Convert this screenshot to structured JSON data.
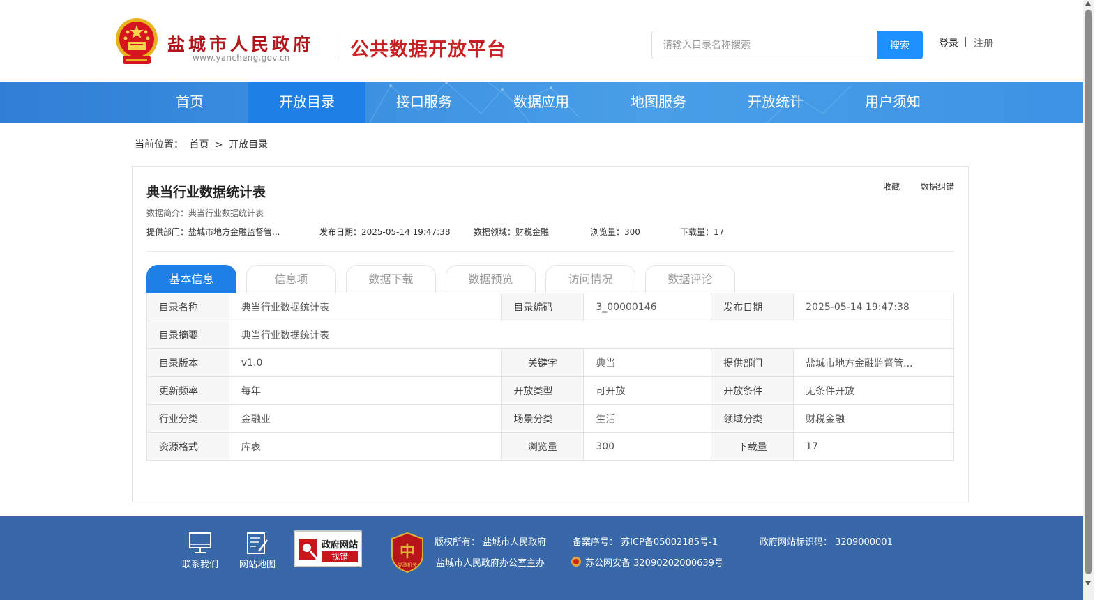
{
  "header": {
    "site_name": "盐城市人民政府",
    "site_url": "www.yancheng.gov.cn",
    "platform_title": "公共数据开放平台",
    "search_placeholder": "请输入目录名称搜索",
    "search_button": "搜索",
    "login": "登录",
    "separator": "|",
    "register": "注册"
  },
  "nav": {
    "items": [
      {
        "label": "首页"
      },
      {
        "label": "开放目录"
      },
      {
        "label": "接口服务"
      },
      {
        "label": "数据应用"
      },
      {
        "label": "地图服务"
      },
      {
        "label": "开放统计"
      },
      {
        "label": "用户须知"
      }
    ],
    "active": "开放目录"
  },
  "breadcrumb": {
    "prefix": "当前位置：",
    "home": "首页",
    "sep": ">",
    "current": "开放目录"
  },
  "dataset": {
    "title": "典当行业数据统计表",
    "collect": "收藏",
    "correct": "数据纠错",
    "summary": "数据简介：典当行业数据统计表",
    "dept": "提供部门：盐城市地方金融监督管...",
    "publish": "发布日期：2025-05-14 19:47:38",
    "field": "数据领域：财税金融",
    "views": "浏览量：300",
    "downloads": "下载量：17"
  },
  "tabs": [
    {
      "label": "基本信息"
    },
    {
      "label": "信息项"
    },
    {
      "label": "数据下载"
    },
    {
      "label": "数据预览"
    },
    {
      "label": "访问情况"
    },
    {
      "label": "数据评论"
    }
  ],
  "info": {
    "r1": {
      "k1": "目录名称",
      "v1": "典当行业数据统计表",
      "k2": "目录编码",
      "v2": "3_00000146",
      "k3": "发布日期",
      "v3": "2025-05-14 19:47:38"
    },
    "r2": {
      "k1": "目录摘要",
      "v1": "典当行业数据统计表"
    },
    "r3": {
      "k1": "目录版本",
      "v1": "v1.0",
      "k2": "关键字",
      "v2": "典当",
      "k3": "提供部门",
      "v3": "盐城市地方金融监督管..."
    },
    "r4": {
      "k1": "更新频率",
      "v1": "每年",
      "k2": "开放类型",
      "v2": "可开放",
      "k3": "开放条件",
      "v3": "无条件开放"
    },
    "r5": {
      "k1": "行业分类",
      "v1": "金融业",
      "k2": "场景分类",
      "v2": "生活",
      "k3": "领域分类",
      "v3": "财税金融"
    },
    "r6": {
      "k1": "资源格式",
      "v1": "库表",
      "k2": "浏览量",
      "v2": "300",
      "k3": "下载量",
      "v3": "17"
    }
  },
  "footer": {
    "contact": "联系我们",
    "sitemap": "网站地图",
    "gov_badge_top": "政府网站",
    "gov_badge_bottom": "找错",
    "dangzheng_text": "党政机关",
    "copyright": "版权所有： 盐城市人民政府",
    "host": "盐城市人民政府办公室主办",
    "icp": "备案序号： 苏ICP备05002185号-1",
    "police": "苏公网安备 32090202000639号",
    "site_code": "政府网站标识码： 3209000001"
  },
  "colors": {
    "brand_red": "#c81f23",
    "nav_blue": "#3b8fe0",
    "active_blue": "#1e7fe6",
    "footer_blue": "#3868a8"
  },
  "icons": [
    "national-emblem-icon",
    "monitor-icon",
    "edit-icon",
    "magnifier-icon",
    "dangzheng-badge-icon",
    "police-badge-icon"
  ]
}
